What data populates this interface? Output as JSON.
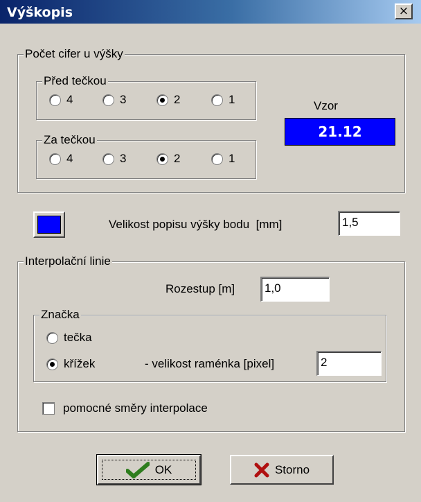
{
  "window": {
    "title": "Výškopis",
    "close_glyph": "×"
  },
  "digits_group": {
    "legend": "Počet cifer u výšky",
    "before_dot": {
      "legend": "Před tečkou",
      "options": [
        "4",
        "3",
        "2",
        "1"
      ],
      "selected": "2"
    },
    "after_dot": {
      "legend": "Za tečkou",
      "options": [
        "4",
        "3",
        "2",
        "1"
      ],
      "selected": "2"
    },
    "sample_label": "Vzor",
    "sample_value": "21.12"
  },
  "label_size": {
    "color_swatch": "#0000ff",
    "label": "Velikost popisu výšky bodu  [mm]",
    "value": "1,5"
  },
  "interpolation": {
    "legend": "Interpolační linie",
    "spacing_label": "Rozestup [m]",
    "spacing_value": "1,0",
    "marker": {
      "legend": "Značka",
      "option_dot": "tečka",
      "option_cross": "křížek",
      "arm_label": "- velikost raménka [pixel]",
      "arm_value": "2",
      "selected": "křížek"
    },
    "aux_checkbox_label": "pomocné směry interpolace",
    "aux_checked": false
  },
  "buttons": {
    "ok": "OK",
    "cancel": "Storno"
  },
  "colors": {
    "accent": "#0000ff",
    "ok_icon": "#2e7d1e",
    "cancel_icon": "#b01010"
  },
  "icons": {
    "ok": "checkmark-icon",
    "cancel": "x-mark-icon"
  }
}
